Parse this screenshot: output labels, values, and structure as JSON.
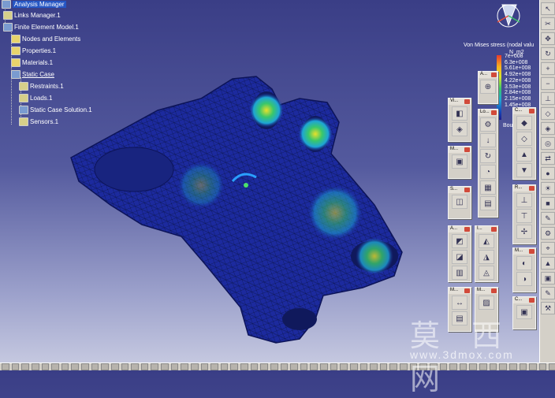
{
  "tree": {
    "root": "Analysis Manager",
    "links": "Links Manager.1",
    "fem": "Finite Element Model.1",
    "nodes": "Nodes and Elements",
    "properties": "Properties.1",
    "materials": "Materials.1",
    "static_case": "Static Case",
    "restraints": "Restraints.1",
    "loads": "Loads.1",
    "solution": "Static Case Solution.1",
    "sensors": "Sensors.1"
  },
  "legend": {
    "title": "Von Mises stress (nodal valu",
    "unit": "N_m2",
    "values": [
      "7e+008",
      "6.3e+008",
      "5.61e+008",
      "4.92e+008",
      "4.22e+008",
      "3.53e+008",
      "2.84e+008",
      "2.15e+008",
      "1.45e+008"
    ],
    "footer": "Bou"
  },
  "toolbars": {
    "a": "A...",
    "v": "Vi...",
    "lo": "Lo...",
    "m1": "M...",
    "s": "S...",
    "a2": "A...",
    "i": "I...",
    "m2": "M...",
    "c1": "C...",
    "r": "R...",
    "m3": "M...",
    "c2": "C..."
  },
  "watermark": {
    "chars": "莫 西 网",
    "url": "www.3dmox.com"
  },
  "colors": {
    "background_top": "#3a3e86",
    "background_bottom": "#c9cce2",
    "part_base": "#1c2a9e",
    "stress_high": "#e83a2d",
    "stress_low": "#1b1c8c"
  }
}
